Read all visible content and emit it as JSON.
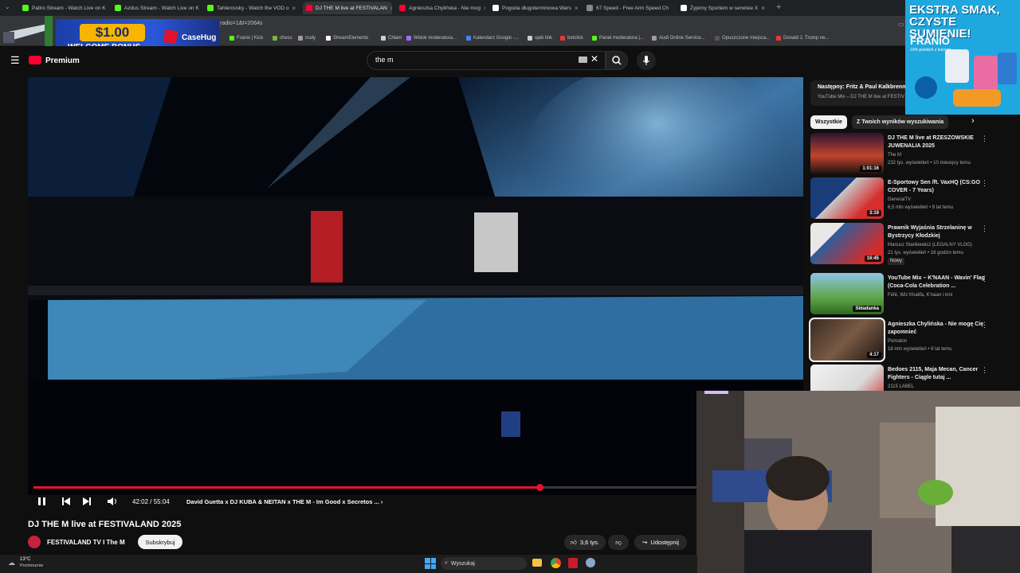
{
  "tabs": [
    {
      "title": "Patiro Stream - Watch Live on K",
      "color": "#53fc18"
    },
    {
      "title": "Azdus Stream - Watch Live on K",
      "color": "#53fc18"
    },
    {
      "title": "Tahlerovsky - Watch the VOD o",
      "color": "#53fc18"
    },
    {
      "title": "DJ THE M live at FESTIVALAN",
      "color": "#ff0033"
    },
    {
      "title": "Agnieszka Chylińska - Nie mog",
      "color": "#ff0033"
    },
    {
      "title": "Pogoda długoterminowa Wars",
      "color": "#ffffff"
    },
    {
      "title": "67 Speed - Free Arm Speed Ch",
      "color": "#888888"
    },
    {
      "title": "Żyjemy Sportem w serwisie X",
      "color": "#ffffff"
    }
  ],
  "url_fragment": "rt_radio=1&t=2064s",
  "bookmarks": [
    "Franio | Kick",
    "chess",
    "nudy",
    "StreamElements",
    "Chłam",
    "Widok moderatora...",
    "Kalendarz Google -...",
    "ujeb link",
    "betclick",
    "Panel moderatora |...",
    "Audi Online Service...",
    "Opuszczone miejsca...",
    "Donald J. Trump ne..."
  ],
  "ad": {
    "amount": "$1.00",
    "text": "WELCOME BONUS",
    "brand": "CaseHug"
  },
  "header": {
    "logo_suffix": "Premium",
    "search_value": "the m"
  },
  "player": {
    "current_time": "42:02",
    "duration": "55:04",
    "progress": 0.7635,
    "chapter": "David Guetta x DJ KUBA & NEITAN x THE M - Im Good x Secretos ..."
  },
  "video": {
    "title": "DJ THE M live at FESTIVALAND 2025",
    "channel": "FESTIVALAND TV I The M",
    "subscribe_label": "Subskrybuj",
    "likes": "3,6 tys.",
    "share_label": "Udostępnij"
  },
  "playlist": {
    "next": "Następny: Fritz & Paul Kalkbrenn",
    "mix": "YouTube Mix – DJ THE M live at FESTIV"
  },
  "chips": [
    "Wszystkie",
    "Z Twoich wyników wyszukiwania"
  ],
  "recommendations": [
    {
      "title": "DJ THE M live at RZESZOWSKIE JUWENALIA 2025",
      "channel": "The M",
      "meta": "232 tys. wyświetleń • 10 miesięcy temu",
      "duration": "1:01:16",
      "badge": ""
    },
    {
      "title": "E-Sportowy Sen /ft. VaxHQ (CS:GO COVER - 7 Years)",
      "channel": "GeneralTV",
      "meta": "6,5 mln wyświetleń • 9 lat temu",
      "duration": "3:19",
      "badge": ""
    },
    {
      "title": "Prawnik Wyjaśnia Strzelaninę w Bystrzycy Kłodzkiej",
      "channel": "Mariusz Stankiewicz (LEGALNY VLOG)",
      "meta": "21 tys. wyświetleń • 16 godzin temu",
      "duration": "16:45",
      "badge": "Nowy"
    },
    {
      "title": "YouTube Mix – K'NAAN - Wavin' Flag (Coca-Cola Celebration ...",
      "channel": "Fėfė, Wiz Khalifa, K'naan i inni",
      "meta": "",
      "duration": "Składanka",
      "badge": ""
    },
    {
      "title": "Agnieszka Chylińska - Nie mogę Cię zapomnieć",
      "channel": "Pomaton",
      "meta": "18 mln wyświetleń • 9 lat temu",
      "duration": "4:17",
      "badge": ""
    },
    {
      "title": "Bedoes 2115, Maja Mecan, Cancer Fighters - Ciągle tutaj ...",
      "channel": "2115 LABEL",
      "meta": "",
      "duration": "",
      "badge": ""
    }
  ],
  "franio_ad": {
    "headline": "EKSTRA SMAK, CZYSTE SUMIENIE!",
    "name": "FRANIO",
    "sub": "10% polskich z korzeni"
  },
  "taskbar": {
    "temp": "13°C",
    "weather": "Pochmurnie",
    "search": "Wyszukaj"
  }
}
